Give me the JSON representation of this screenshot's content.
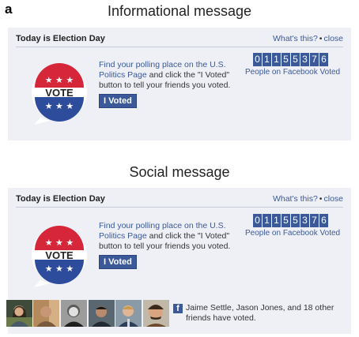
{
  "panel_letter": "a",
  "sections": [
    {
      "heading": "Informational message",
      "title": "Today is Election Day",
      "whats_this": "What's this?",
      "close": "close",
      "badge_text": "VOTE",
      "instr_link": "Find your polling place on the U.S. Politics Page",
      "instr_text": " and click the \"I Voted\" button to tell your friends you voted.",
      "button": "I Voted",
      "counter_digits": [
        "0",
        "1",
        "1",
        "5",
        "5",
        "3",
        "7",
        "6"
      ],
      "counter_label": "People on Facebook Voted"
    },
    {
      "heading": "Social message",
      "title": "Today is Election Day",
      "whats_this": "What's this?",
      "close": "close",
      "badge_text": "VOTE",
      "instr_link": "Find your polling place on the U.S. Politics Page",
      "instr_text": " and click the \"I Voted\" button to tell your friends you voted.",
      "button": "I Voted",
      "counter_digits": [
        "0",
        "1",
        "1",
        "5",
        "5",
        "3",
        "7",
        "6"
      ],
      "counter_label": "People on Facebook Voted",
      "fb_icon": "f",
      "friends_text": "Jaime Settle, Jason Jones, and 18 other friends have voted."
    }
  ],
  "colors": {
    "facebook_blue": "#3b5998",
    "badge_red": "#d6263a",
    "badge_blue": "#2d4c9b",
    "box_bg": "#eef0f6"
  },
  "icons": {
    "vote_badge": "vote-badge-icon",
    "facebook": "facebook-icon",
    "friend_photo": "friend-photo"
  }
}
